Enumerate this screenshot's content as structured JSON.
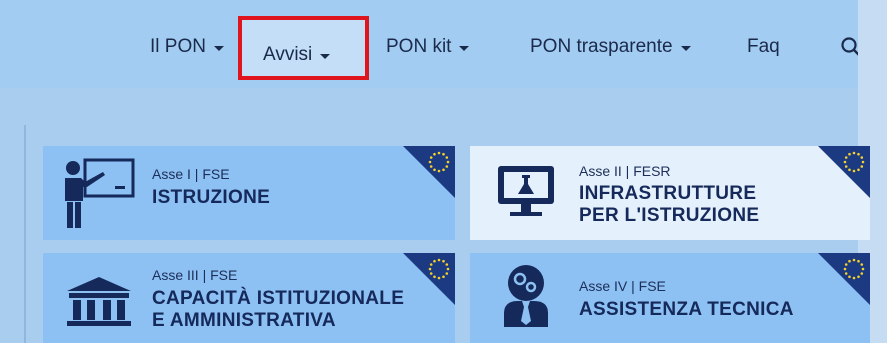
{
  "nav": {
    "items": [
      {
        "label": "Il PON"
      },
      {
        "label": "Avvisi"
      },
      {
        "label": "PON kit"
      },
      {
        "label": "PON trasparente"
      },
      {
        "label": "Faq"
      }
    ]
  },
  "cards": [
    {
      "subtitle": "Asse I | FSE",
      "title_line1": "ISTRUZIONE",
      "title_line2": "",
      "icon": "teacher-blackboard-icon"
    },
    {
      "subtitle": "Asse II | FESR",
      "title_line1": "INFRASTRUTTURE",
      "title_line2": "PER L'ISTRUZIONE",
      "icon": "computer-monitor-flask-icon"
    },
    {
      "subtitle": "Asse III | FSE",
      "title_line1": "CAPACITÀ ISTITUZIONALE",
      "title_line2": "E AMMINISTRATIVA",
      "icon": "institution-building-icon"
    },
    {
      "subtitle": "Asse IV | FSE",
      "title_line1": "ASSISTENZA TECNICA",
      "title_line2": "",
      "icon": "technician-gears-icon"
    }
  ],
  "colors": {
    "highlight_border": "#e0141c",
    "eu_flag": "#1c3a82",
    "card_blue": "#8dc0f3",
    "card_light": "#e4f0fb"
  }
}
